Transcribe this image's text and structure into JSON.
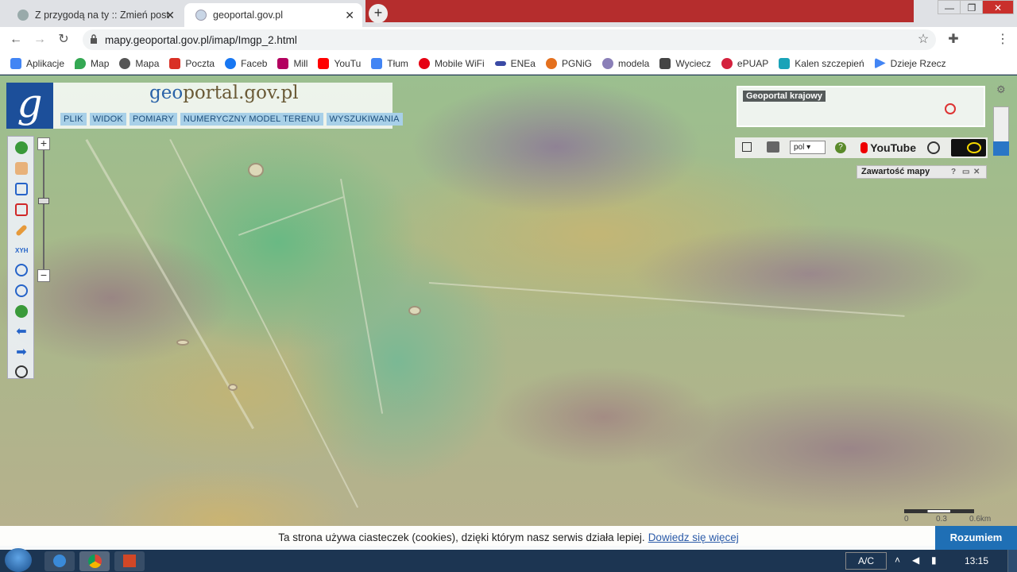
{
  "browser": {
    "tabs": [
      {
        "title": "Z przygodą na ty :: Zmień post",
        "active": false
      },
      {
        "title": "geoportal.gov.pl",
        "active": true
      }
    ],
    "url": "mapy.geoportal.gov.pl/imap/Imgp_2.html",
    "bookmarks": [
      {
        "label": "Aplikacje",
        "icon": "apps-grid-icon",
        "color": "#4285f4"
      },
      {
        "label": "Map",
        "icon": "maps-pin-icon",
        "color": "#34a853"
      },
      {
        "label": "Mapa",
        "icon": "globe-icon",
        "color": "#555555"
      },
      {
        "label": "Poczta",
        "icon": "mail-icon",
        "color": "#d93025"
      },
      {
        "label": "Faceb",
        "icon": "facebook-icon",
        "color": "#1877f2"
      },
      {
        "label": "Mill",
        "icon": "mill-icon",
        "color": "#b3005f"
      },
      {
        "label": "YouTu",
        "icon": "youtube-icon",
        "color": "#ff0000"
      },
      {
        "label": "Tłum",
        "icon": "translate-icon",
        "color": "#4285f4"
      },
      {
        "label": "Mobile WiFi",
        "icon": "huawei-icon",
        "color": "#e60012"
      },
      {
        "label": "ENEa",
        "icon": "enea-icon",
        "color": "#3a4aa5"
      },
      {
        "label": "PGNiG",
        "icon": "pgnig-icon",
        "color": "#e4701e"
      },
      {
        "label": "modela",
        "icon": "modela-icon",
        "color": "#8a7fb8"
      },
      {
        "label": "Wyciecz",
        "icon": "car-icon",
        "color": "#444444"
      },
      {
        "label": "ePUAP",
        "icon": "epuap-icon",
        "color": "#d4213d"
      },
      {
        "label": "Kalen szczepień",
        "icon": "calendar-icon",
        "color": "#1aa3b8"
      },
      {
        "label": "Dzieje Rzecz",
        "icon": "play-icon",
        "color": "#4285f4"
      }
    ]
  },
  "geoportal": {
    "logo_letter": "g",
    "title_prefix": "geo",
    "title_rest": "portal.gov.pl",
    "menu": [
      "PLIK",
      "WIDOK",
      "POMIARY",
      "NUMERYCZNY MODEL TERENU",
      "WYSZUKIWANIA"
    ],
    "minimap_label": "Geoportal krajowy",
    "language": "pol",
    "youtube_label": "YouTube",
    "panel_title": "Zawartość mapy",
    "scale_labels": [
      "0",
      "0.3",
      "0.6km"
    ],
    "zoom_in": "+",
    "zoom_out": "−"
  },
  "cookie_bar": {
    "text": "Ta strona używa ciasteczek (cookies), dzięki którym nasz serwis działa lepiej.",
    "link": "Dowiedz się więcej",
    "button": "Rozumiem"
  },
  "taskbar": {
    "language": "A/C",
    "time": "13:15"
  }
}
